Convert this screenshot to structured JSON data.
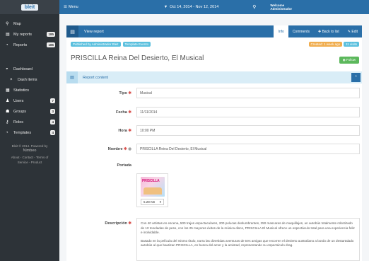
{
  "app": {
    "logo": "bleit"
  },
  "sidebar": {
    "items": [
      {
        "icon": "map-marker-icon",
        "glyph": "⚲",
        "label": "Map",
        "badge": ""
      },
      {
        "icon": "file-icon",
        "glyph": "▤",
        "label": "My reports",
        "badge": "185"
      },
      {
        "icon": "reports-icon",
        "glyph": "◔",
        "label": "Reports",
        "badge": "186"
      }
    ],
    "items2": [
      {
        "icon": "dashboard-icon",
        "glyph": "◓",
        "label": "Dashboard",
        "badge": ""
      },
      {
        "icon": "dashboard-icon",
        "glyph": "◓",
        "label": "Dash items",
        "badge": ""
      },
      {
        "icon": "statistics-icon",
        "glyph": "▦",
        "label": "Statistics",
        "badge": ""
      },
      {
        "icon": "user-icon",
        "glyph": "♟",
        "label": "Users",
        "badge": "7"
      },
      {
        "icon": "groups-icon",
        "glyph": "☗",
        "label": "Groups",
        "badge": "3"
      },
      {
        "icon": "key-icon",
        "glyph": "⚷",
        "label": "Roles",
        "badge": "4"
      },
      {
        "icon": "templates-icon",
        "glyph": "◔",
        "label": "Templates",
        "badge": "4"
      }
    ],
    "footer_line1": "Bleit © 2014. Powered by",
    "footer_line2": "Nimbeo",
    "footer_line3": "About - Contact - Terms of",
    "footer_line4": "Service - Product"
  },
  "topbar": {
    "menu": "Menu",
    "date_range": "Oct 14, 2014 - Nov 12, 2014",
    "welcome_line1": "Welcome",
    "welcome_line2": "Administrador"
  },
  "tabs": {
    "title": "View report",
    "info": "Info",
    "comments": "Comments",
    "back": "Back to list",
    "edit": "Edit"
  },
  "report": {
    "published_by": "Published by Administrador Bleit",
    "template": "Template Evento",
    "created": "Created: 1 week ago",
    "views": "11 visits",
    "title": "PRISCILLA Reina Del Desierto, El Musical",
    "follow": "Follow",
    "section": "Report content"
  },
  "fields": [
    {
      "label": "Tipo",
      "req": "✱",
      "eye": "",
      "value": "Musical"
    },
    {
      "label": "Fecha",
      "req": "✱",
      "eye": "",
      "value": "11/11/2014"
    },
    {
      "label": "Hora",
      "req": "✱",
      "eye": "",
      "value": "10:00 PM"
    },
    {
      "label": "Nombre",
      "req": "✱",
      "eye": "◉",
      "value": "PRISCILLA Reina Del Desierto, El Musical"
    }
  ],
  "portada": {
    "label": "Portada",
    "cover_text": "PRISCILLA",
    "size": "5.28 KB"
  },
  "descripcion": {
    "label": "Descripción",
    "req": "✱",
    "p1": "Con 40 artistas en escena, 500 trajes espectaculares, 200 pelucas deslumbrantes, 250 mascaras de maquillajes, un autobús totalmente robotizado de 10 toneladas de peso, con los 25 mayores éxitos de la música disco, PRISCILLA El Musical ofrece un espectáculo total para una experiencia feliz e inolvidable.",
    "p2": "Basado en la película del mismo título, narra las divertidas aventuras de tres amigas que recorren el desierto australiano a bordo de un destartalado autobús al que bautizan PRISCILLA, en busca del amor y la amistad, representando su espectáculo drag."
  },
  "colors": {
    "primary": "#2a6fa8",
    "sidebar": "#2d3338",
    "success": "#5cb85c",
    "warning": "#f0ad4e",
    "required": "#d9534f"
  }
}
